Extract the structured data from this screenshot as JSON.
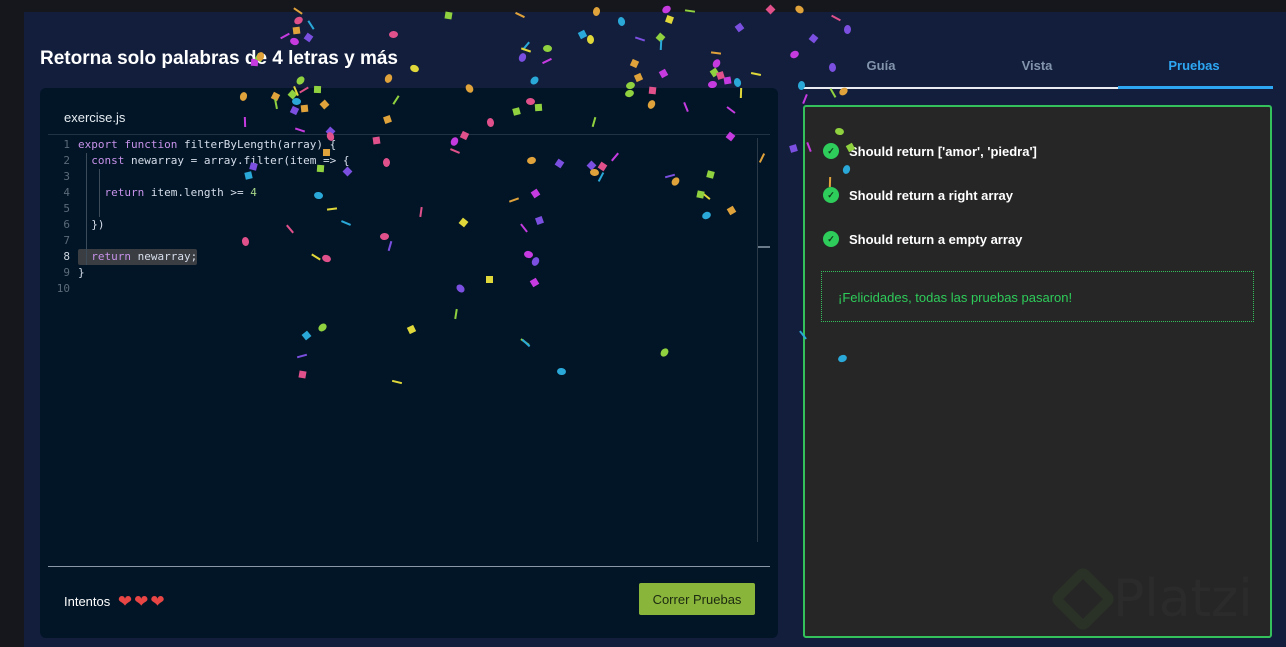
{
  "title": "Retorna solo palabras de 4 letras y más",
  "editor": {
    "filename": "exercise.js",
    "lines": [
      {
        "n": "1",
        "tokens": [
          [
            "kw",
            "export "
          ],
          [
            "kw",
            "function "
          ],
          [
            "tx",
            "filterByLength(array) {"
          ]
        ]
      },
      {
        "n": "2",
        "tokens": [
          [
            "tx",
            "  "
          ],
          [
            "kw",
            "const "
          ],
          [
            "tx",
            "newarray = array.filter(item => {"
          ]
        ]
      },
      {
        "n": "3",
        "tokens": []
      },
      {
        "n": "4",
        "tokens": [
          [
            "tx",
            "    "
          ],
          [
            "kw",
            "return "
          ],
          [
            "tx",
            "item.length >= "
          ],
          [
            "nm",
            "4"
          ]
        ]
      },
      {
        "n": "5",
        "tokens": []
      },
      {
        "n": "6",
        "tokens": [
          [
            "tx",
            "  })"
          ]
        ]
      },
      {
        "n": "7",
        "tokens": []
      },
      {
        "n": "8",
        "tokens": [
          [
            "tx",
            "  "
          ],
          [
            "kw",
            "return "
          ],
          [
            "tx",
            "newarray;"
          ]
        ],
        "active": true
      },
      {
        "n": "9",
        "tokens": [
          [
            "tx",
            "}"
          ]
        ]
      },
      {
        "n": "10",
        "tokens": []
      }
    ]
  },
  "footer": {
    "attempts_label": "Intentos",
    "hearts": [
      "❤",
      "❤",
      "❤"
    ],
    "run_button": "Correr Pruebas"
  },
  "tabs": [
    {
      "label": "Guía"
    },
    {
      "label": "Vista"
    },
    {
      "label": "Pruebas",
      "active": true
    }
  ],
  "tests": [
    {
      "label": "Should return ['amor', 'piedra']",
      "status": "passed"
    },
    {
      "label": "Should return a right array",
      "status": "passed"
    },
    {
      "label": "Should return a empty array",
      "status": "passed"
    }
  ],
  "success_message": "¡Felicidades, todas las pruebas pasaron!",
  "watermark": "Platzi",
  "colors": {
    "accent": "#2ea7f2",
    "success": "#2ecc5a",
    "run": "#8ab53b",
    "confetti": [
      "#c53be0",
      "#e0508a",
      "#2aa8d8",
      "#8fd13f",
      "#e0a23a",
      "#7b4fe0",
      "#e0d83a"
    ]
  }
}
